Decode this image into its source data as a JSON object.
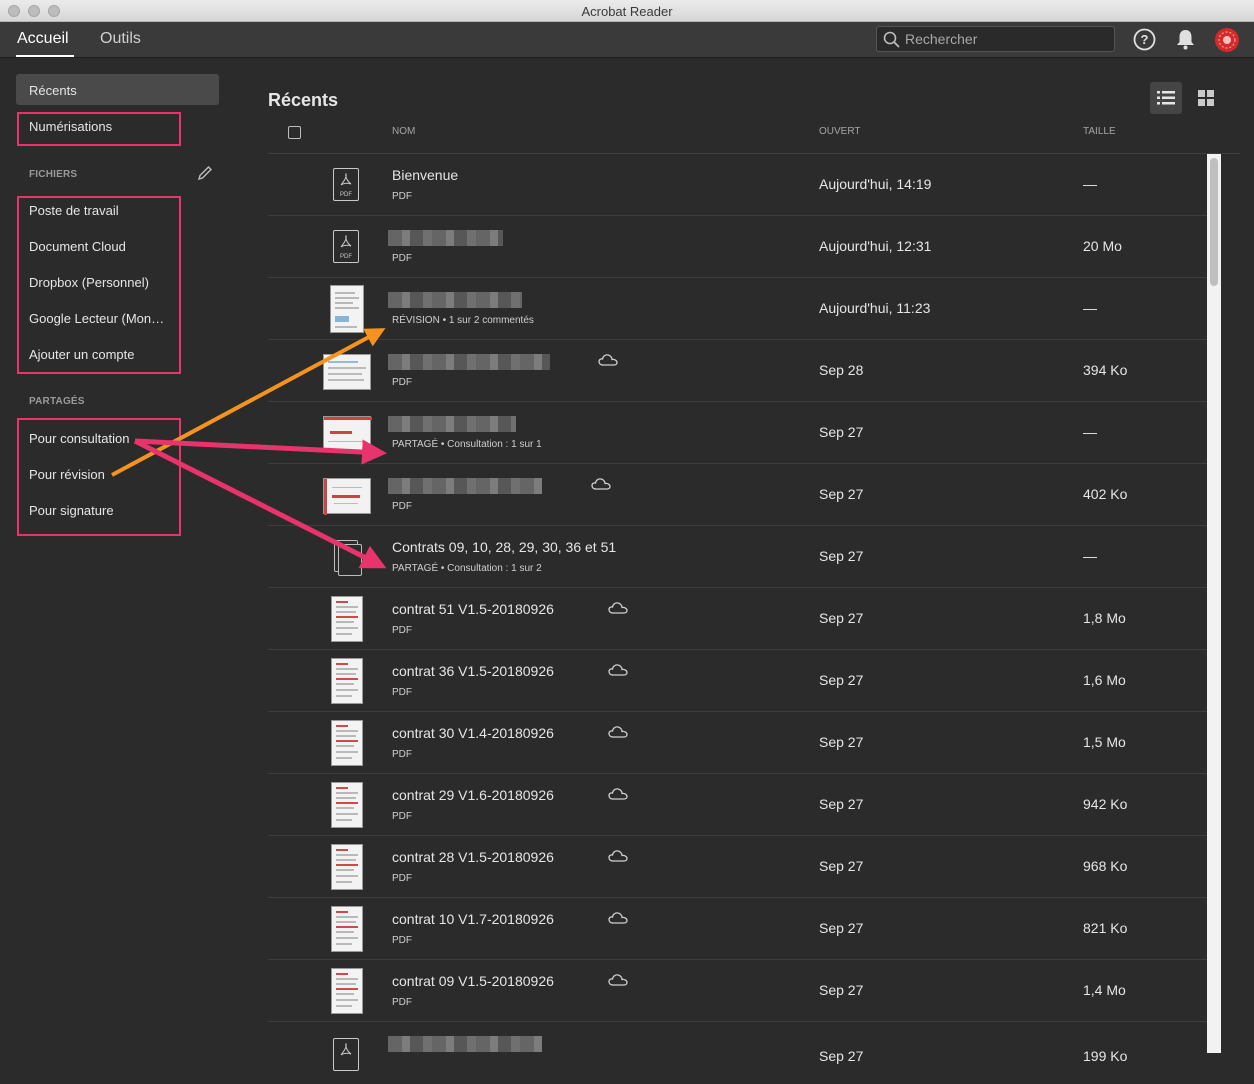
{
  "window": {
    "title": "Acrobat Reader"
  },
  "topnav": {
    "tabs": [
      {
        "label": "Accueil"
      },
      {
        "label": "Outils"
      }
    ],
    "search_placeholder": "Rechercher"
  },
  "sidebar": {
    "recents": "Récents",
    "scans": "Numérisations",
    "files_section": "FICHIERS",
    "files": [
      "Poste de travail",
      "Document Cloud",
      "Dropbox (Personnel)",
      "Google Lecteur (Mon…",
      "Ajouter un compte"
    ],
    "shared_section": "PARTAGÉS",
    "shared": [
      "Pour consultation",
      "Pour révision",
      "Pour signature"
    ]
  },
  "main": {
    "heading": "Récents",
    "columns": {
      "name": "NOM",
      "opened": "OUVERT",
      "size": "TAILLE"
    },
    "rows": [
      {
        "name": "Bienvenue",
        "type": "PDF",
        "opened": "Aujourd'hui, 14:19",
        "size": "—"
      },
      {
        "name": "",
        "type": "PDF",
        "opened": "Aujourd'hui, 12:31",
        "size": "20 Mo"
      },
      {
        "name": "",
        "type": "RÉVISION  •  1 sur 2 commentés",
        "opened": "Aujourd'hui, 11:23",
        "size": "—"
      },
      {
        "name": "",
        "type": "PDF",
        "opened": "Sep 28",
        "size": "394 Ko"
      },
      {
        "name": "",
        "type": "PARTAGÉ  •  Consultation : 1 sur 1",
        "opened": "Sep 27",
        "size": "—"
      },
      {
        "name": "",
        "type": "PDF",
        "opened": "Sep 27",
        "size": "402 Ko"
      },
      {
        "name": "Contrats 09, 10, 28, 29, 30, 36 et 51",
        "type": "PARTAGÉ  •  Consultation : 1 sur 2",
        "opened": "Sep 27",
        "size": "—"
      },
      {
        "name": "contrat 51 V1.5-20180926",
        "type": "PDF",
        "opened": "Sep 27",
        "size": "1,8 Mo"
      },
      {
        "name": "contrat 36 V1.5-20180926",
        "type": "PDF",
        "opened": "Sep 27",
        "size": "1,6 Mo"
      },
      {
        "name": "contrat 30 V1.4-20180926",
        "type": "PDF",
        "opened": "Sep 27",
        "size": "1,5 Mo"
      },
      {
        "name": "contrat 29 V1.6-20180926",
        "type": "PDF",
        "opened": "Sep 27",
        "size": "942 Ko"
      },
      {
        "name": "contrat 28 V1.5-20180926",
        "type": "PDF",
        "opened": "Sep 27",
        "size": "968 Ko"
      },
      {
        "name": "contrat 10 V1.7-20180926",
        "type": "PDF",
        "opened": "Sep 27",
        "size": "821 Ko"
      },
      {
        "name": "contrat 09 V1.5-20180926",
        "type": "PDF",
        "opened": "Sep 27",
        "size": "1,4 Mo"
      },
      {
        "name": "",
        "type": "",
        "opened": "Sep 27",
        "size": "199 Ko"
      }
    ]
  },
  "colors": {
    "highlight_box": "#e8336d",
    "arrow_pink": "#e8336d",
    "arrow_orange": "#f5931f",
    "avatar": "#d32b2b"
  },
  "icons": [
    "search-icon",
    "help-icon",
    "bell-icon",
    "avatar-icon",
    "pencil-icon",
    "list-view-icon",
    "grid-view-icon",
    "pdf-file-icon",
    "cloud-icon"
  ]
}
